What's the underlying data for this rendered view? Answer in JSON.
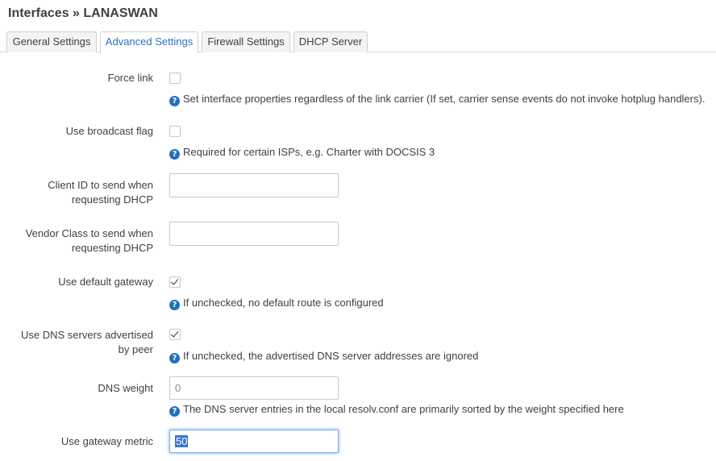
{
  "page": {
    "title": "Interfaces » LANASWAN"
  },
  "tabs": [
    {
      "label": "General Settings",
      "active": false
    },
    {
      "label": "Advanced Settings",
      "active": true
    },
    {
      "label": "Firewall Settings",
      "active": false
    },
    {
      "label": "DHCP Server",
      "active": false
    }
  ],
  "fields": {
    "force_link": {
      "label": "Force link",
      "checked": false,
      "hint": "Set interface properties regardless of the link carrier (If set, carrier sense events do not invoke hotplug handlers)."
    },
    "broadcast_flag": {
      "label": "Use broadcast flag",
      "checked": false,
      "hint": "Required for certain ISPs, e.g. Charter with DOCSIS 3"
    },
    "client_id": {
      "label_line1": "Client ID to send when",
      "label_line2": "requesting DHCP",
      "value": ""
    },
    "vendor_class": {
      "label_line1": "Vendor Class to send when",
      "label_line2": "requesting DHCP",
      "value": ""
    },
    "default_gateway": {
      "label": "Use default gateway",
      "checked": true,
      "hint": "If unchecked, no default route is configured"
    },
    "peer_dns": {
      "label_line1": "Use DNS servers advertised",
      "label_line2": "by peer",
      "checked": true,
      "hint": "If unchecked, the advertised DNS server addresses are ignored"
    },
    "dns_weight": {
      "label": "DNS weight",
      "placeholder": "0",
      "hint": "The DNS server entries in the local resolv.conf are primarily sorted by the weight specified here"
    },
    "gateway_metric": {
      "label": "Use gateway metric",
      "value": "50"
    }
  },
  "icons": {
    "help": "help-circle-icon",
    "check": "checkmark-icon"
  },
  "colors": {
    "accent": "#2a74bf",
    "help_icon": "#1f6fbf",
    "focus": "#7fb3e6"
  }
}
